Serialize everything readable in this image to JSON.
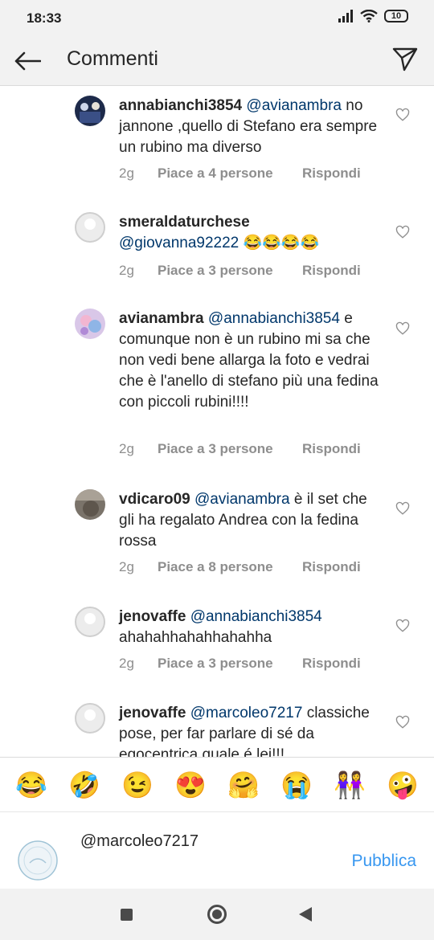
{
  "status": {
    "time": "18:33",
    "battery": "10"
  },
  "header": {
    "title": "Commenti"
  },
  "comments": [
    {
      "username": "annabianchi3854",
      "mention": "@avianambra",
      "text": "no jannone ,quello di Stefano era sempre un rubino ma diverso",
      "age": "2g",
      "likes": "Piace a 4 persone",
      "reply": "Rispondi"
    },
    {
      "username": "smeraldaturchese",
      "mention": "",
      "text": "@giovanna92222 😂😂😂😂",
      "age": "2g",
      "likes": "Piace a 3 persone",
      "reply": "Rispondi"
    },
    {
      "username": "avianambra",
      "mention": "@annabianchi3854",
      "text": "e comunque non è  un rubino mi sa che non vedi bene allarga la foto  e vedrai che è l'anello di stefano più una fedina con piccoli rubini!!!!",
      "age": "2g",
      "likes": "Piace a 3 persone",
      "reply": "Rispondi"
    },
    {
      "username": "vdicaro09",
      "mention": "@avianambra",
      "text": " è il set che gli ha regalato Andrea con la fedina rossa",
      "age": "2g",
      "likes": "Piace a 8 persone",
      "reply": "Rispondi"
    },
    {
      "username": "jenovaffe",
      "mention": "@annabianchi3854",
      "text": "ahahahhahahhahahha",
      "age": "2g",
      "likes": "Piace a 3 persone",
      "reply": "Rispondi"
    },
    {
      "username": "jenovaffe",
      "mention": "@marcoleo7217",
      "text": "classiche pose, per far parlare di sé da egocentrica quale é lei!!!",
      "age": "",
      "likes": "",
      "reply": ""
    }
  ],
  "emoji_bar": [
    "😂",
    "🤣",
    "😉",
    "😍",
    "🤗",
    "😭",
    "👭",
    "🤪"
  ],
  "composer": {
    "text": "@marcoleo7217",
    "publish": "Pubblica"
  }
}
